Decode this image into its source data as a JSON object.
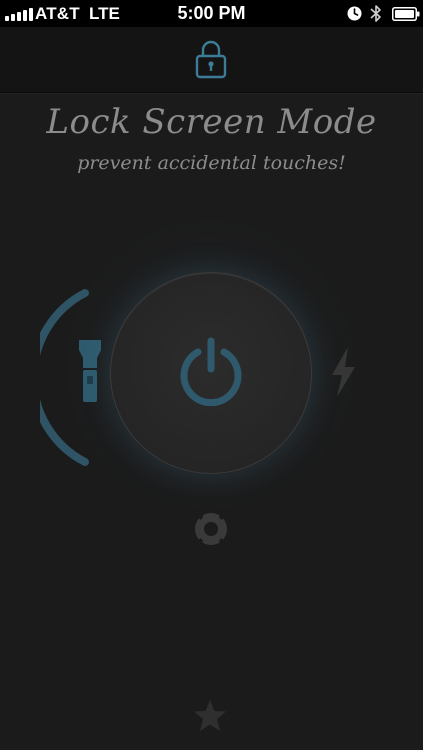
{
  "status_bar": {
    "carrier": "AT&T",
    "network": "LTE",
    "time": "5:00 PM"
  },
  "icons": {
    "status_signal": "signal-icon",
    "status_alarm": "alarm-clock-icon",
    "status_bluetooth": "bluetooth-icon",
    "status_battery": "battery-icon",
    "nav_lock": "lock-icon",
    "power": "power-icon",
    "flashlight": "flashlight-icon",
    "strobe": "lightning-bolt-icon",
    "help": "lifebuoy-icon",
    "favorite": "star-icon"
  },
  "colors": {
    "accent": "#3d6f86",
    "background": "#1b1b1b",
    "text": "#8c8c8c"
  },
  "header": {
    "title": "Lock Screen Mode",
    "subtitle": "prevent accidental touches!"
  }
}
